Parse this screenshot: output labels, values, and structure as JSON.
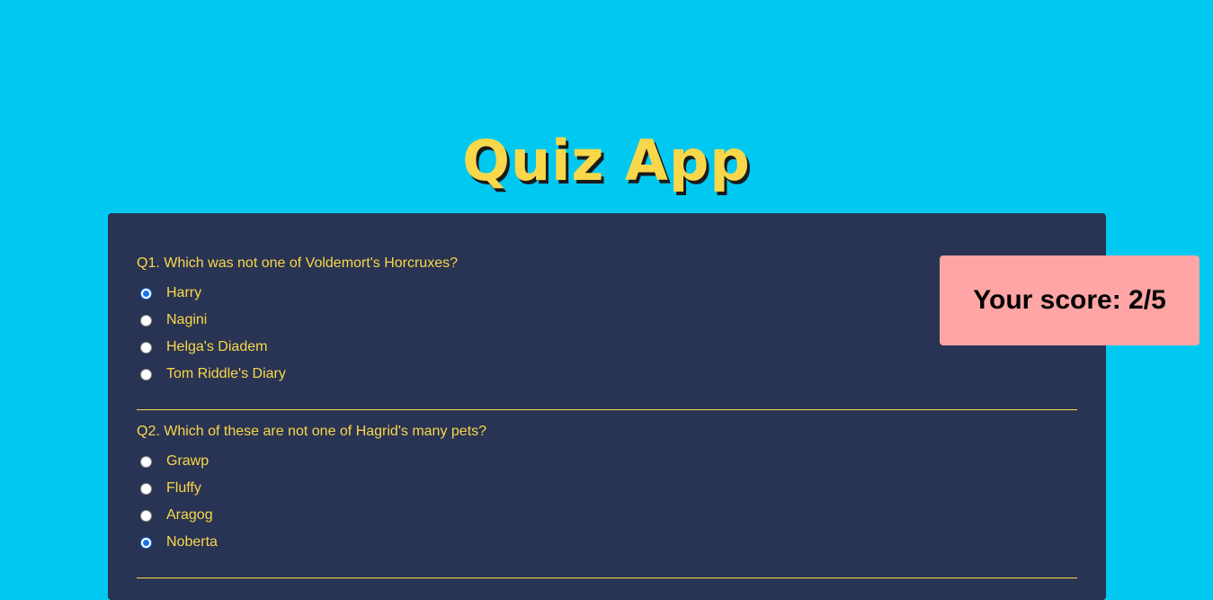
{
  "app": {
    "title": "Quiz App"
  },
  "colors": {
    "background": "#00c8f0",
    "card": "#293353",
    "accent": "#f8d84a",
    "score_bg": "#ffa5a5"
  },
  "questions": [
    {
      "text": "Q1. Which was not one of Voldemort's Horcruxes?",
      "options": [
        "Harry",
        "Nagini",
        "Helga's Diadem",
        "Tom Riddle's Diary"
      ],
      "selected": "Harry"
    },
    {
      "text": "Q2. Which of these are not one of Hagrid's many pets?",
      "options": [
        "Grawp",
        "Fluffy",
        "Aragog",
        "Noberta"
      ],
      "selected": "Noberta"
    }
  ],
  "score": {
    "label": "Your score: 2/5"
  }
}
